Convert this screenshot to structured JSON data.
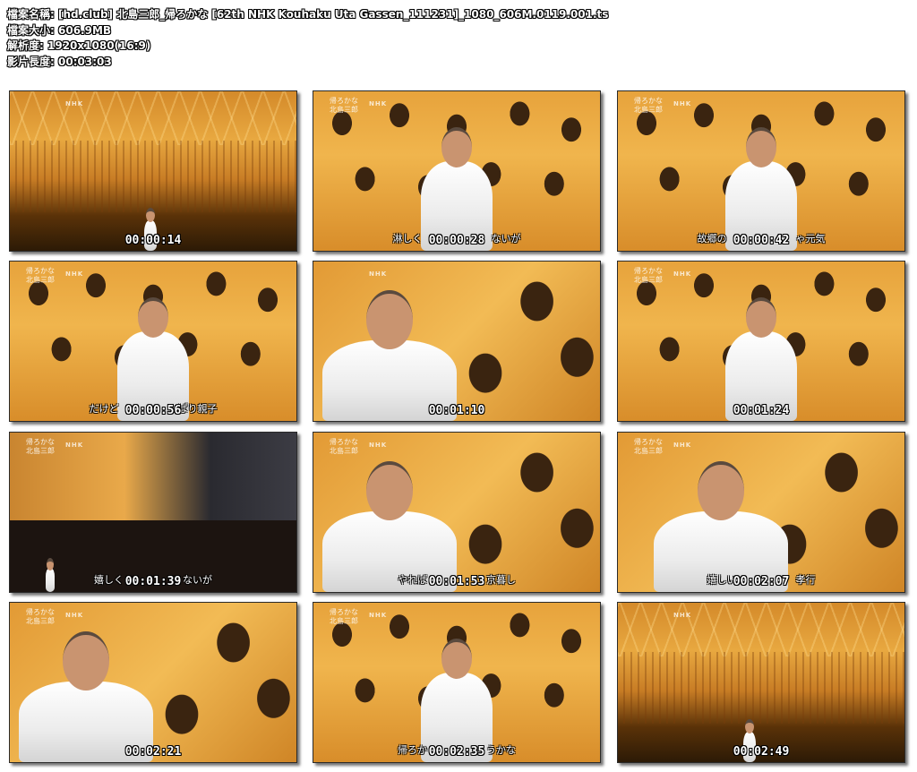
{
  "file_info": {
    "name_label": "檔案名稱:",
    "name_value": "[hd.club] 北島三郎_帰ろかな [62th NHK Kouhaku Uta Gassen_111231]_1080_606M.0119.001.ts",
    "size_label": "檔案大小:",
    "size_value": "606.9MB",
    "resolution_label": "解析度:",
    "resolution_value": "1920x1080(16:9)",
    "duration_label": "影片長度:",
    "duration_value": "00:03:03"
  },
  "thumbnails": [
    {
      "timestamp": "00:00:14",
      "scene": "wide",
      "title": "",
      "subtitle": ""
    },
    {
      "timestamp": "00:00:28",
      "scene": "crowd",
      "title": "帰ろかな\n北島三郎",
      "subtitle": "淋しく　　　　　　　ないが"
    },
    {
      "timestamp": "00:00:42",
      "scene": "crowd",
      "title": "帰ろかな\n北島三郎",
      "subtitle": "故郷の　　　　　　　ゃ元気"
    },
    {
      "timestamp": "00:00:56",
      "scene": "crowd",
      "title": "帰ろかな\n北島三郎",
      "subtitle": "だけど　　　　　　ぱり親子"
    },
    {
      "timestamp": "00:01:10",
      "scene": "close",
      "title": "",
      "subtitle": ""
    },
    {
      "timestamp": "00:01:24",
      "scene": "crowd",
      "title": "帰ろかな\n北島三郎",
      "subtitle": ""
    },
    {
      "timestamp": "00:01:39",
      "scene": "stage",
      "title": "帰ろかな\n北島三郎",
      "subtitle": "嬉しく　　　　　　ないが"
    },
    {
      "timestamp": "00:01:53",
      "scene": "close",
      "title": "帰ろかな\n北島三郎",
      "subtitle": "やれば　　　　　　京暮し"
    },
    {
      "timestamp": "00:02:07",
      "scene": "close",
      "title": "帰ろかな\n北島三郎",
      "subtitle": "嬉しい　　　　　　孝行"
    },
    {
      "timestamp": "00:02:21",
      "scene": "close",
      "title": "帰ろかな\n北島三郎",
      "subtitle": ""
    },
    {
      "timestamp": "00:02:35",
      "scene": "crowd",
      "title": "帰ろかな\n北島三郎",
      "subtitle": "帰ろか　　　　　　うかな"
    },
    {
      "timestamp": "00:02:49",
      "scene": "wide",
      "title": "",
      "subtitle": ""
    }
  ],
  "logo_text": "NHK"
}
